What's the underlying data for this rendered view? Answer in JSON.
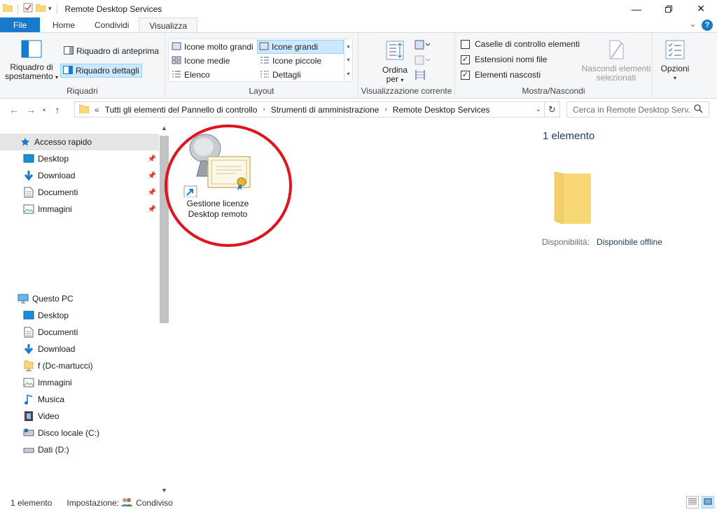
{
  "window": {
    "title": "Remote Desktop Services",
    "colors": {
      "accent": "#1979ca",
      "selection": "#cce8ff",
      "highlight_circle": "#e0141e",
      "link": "#1f3d66"
    }
  },
  "tabs": [
    {
      "label": "File"
    },
    {
      "label": "Home"
    },
    {
      "label": "Condividi"
    },
    {
      "label": "Visualizza",
      "active": true
    }
  ],
  "ribbon": {
    "panes": {
      "group_label": "Riquadri",
      "nav_pane_line1": "Riquadro di",
      "nav_pane_line2": "spostamento",
      "preview_pane": "Riquadro di anteprima",
      "details_pane": "Riquadro dettagli"
    },
    "layout": {
      "group_label": "Layout",
      "options": [
        "Icone molto grandi",
        "Icone grandi",
        "Icone medie",
        "Icone piccole",
        "Elenco",
        "Dettagli"
      ],
      "selected": "Icone grandi"
    },
    "current_view": {
      "group_label": "Visualizzazione corrente",
      "sort_line1": "Ordina",
      "sort_line2": "per"
    },
    "show_hide": {
      "group_label": "Mostra/Nascondi",
      "checkboxes": [
        {
          "label": "Caselle di controllo elementi",
          "checked": false
        },
        {
          "label": "Estensioni nomi file",
          "checked": true
        },
        {
          "label": "Elementi nascosti",
          "checked": true
        }
      ],
      "hide_selected_line1": "Nascondi elementi",
      "hide_selected_line2": "selezionati"
    },
    "options_label": "Opzioni"
  },
  "address": {
    "overflow": "«",
    "crumbs": [
      "Tutti gli elementi del Pannello di controllo",
      "Strumenti di amministrazione",
      "Remote Desktop Services"
    ],
    "search_placeholder": "Cerca in Remote Desktop Serv..."
  },
  "nav_pane": {
    "quick_access": "Accesso rapido",
    "quick_items": [
      {
        "label": "Desktop",
        "icon": "desktop-icon",
        "pinned": true
      },
      {
        "label": "Download",
        "icon": "download-icon",
        "pinned": true
      },
      {
        "label": "Documenti",
        "icon": "documents-icon",
        "pinned": true
      },
      {
        "label": "Immagini",
        "icon": "pictures-icon",
        "pinned": true
      }
    ],
    "this_pc": "Questo PC",
    "pc_items": [
      {
        "label": "Desktop",
        "icon": "desktop-icon"
      },
      {
        "label": "Documenti",
        "icon": "documents-icon"
      },
      {
        "label": "Download",
        "icon": "download-icon"
      },
      {
        "label": "f (Dc-martucci)",
        "icon": "network-drive-icon"
      },
      {
        "label": "Immagini",
        "icon": "pictures-icon"
      },
      {
        "label": "Musica",
        "icon": "music-icon"
      },
      {
        "label": "Video",
        "icon": "video-icon"
      },
      {
        "label": "Disco locale (C:)",
        "icon": "local-disk-icon"
      },
      {
        "label": "Dati (D:)",
        "icon": "drive-icon"
      }
    ]
  },
  "content": {
    "items": [
      {
        "line1": "Gestione licenze",
        "line2": "Desktop remoto",
        "icon": "rd-licensing-shortcut-icon"
      }
    ]
  },
  "details": {
    "count": "1 elemento",
    "availability_label": "Disponibilità:",
    "availability_value": "Disponibile offline"
  },
  "status": {
    "count": "1 elemento",
    "setting_label": "Impostazione:",
    "setting_value": "Condiviso"
  }
}
